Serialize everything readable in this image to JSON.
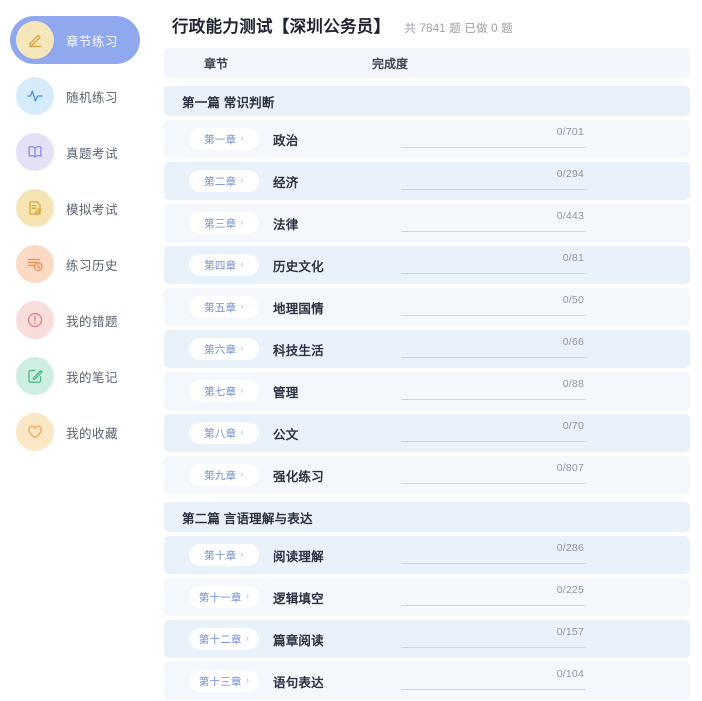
{
  "sidebar": {
    "items": [
      {
        "label": "章节练习",
        "icon": "pencil-icon",
        "icon_bg": "#f5e6bc",
        "icon_color": "#d9a441",
        "active": true
      },
      {
        "label": "随机练习",
        "icon": "pulse-icon",
        "icon_bg": "#d7ecfa",
        "icon_color": "#4a90e2",
        "active": false
      },
      {
        "label": "真题考试",
        "icon": "book-icon",
        "icon_bg": "#e2e1f7",
        "icon_color": "#8f8de0",
        "active": false
      },
      {
        "label": "模拟考试",
        "icon": "document-edit-icon",
        "icon_bg": "#f6e4b4",
        "icon_color": "#dba63c",
        "active": false
      },
      {
        "label": "练习历史",
        "icon": "history-icon",
        "icon_bg": "#fbd9c2",
        "icon_color": "#ef8f55",
        "active": false
      },
      {
        "label": "我的错题",
        "icon": "exclamation-circle-icon",
        "icon_bg": "#f9dcdc",
        "icon_color": "#e8807f",
        "active": false
      },
      {
        "label": "我的笔记",
        "icon": "note-edit-icon",
        "icon_bg": "#cdeee0",
        "icon_color": "#4cb98a",
        "active": false
      },
      {
        "label": "我的收藏",
        "icon": "heart-icon",
        "icon_bg": "#fbe7c6",
        "icon_color": "#efa95c",
        "active": false
      }
    ],
    "active_bg": "#8fa8ee"
  },
  "header": {
    "title": "行政能力测试【深圳公务员】",
    "meta": "共 7841 题 已做 0 题"
  },
  "table": {
    "columns": {
      "chapter": "章节",
      "completion": "完成度"
    },
    "sections": [
      {
        "title": "第一篇 常识判断",
        "rows": [
          {
            "chapter": "第一章",
            "name": "政治",
            "done": 0,
            "total": 701,
            "progress": "0/701"
          },
          {
            "chapter": "第二章",
            "name": "经济",
            "done": 0,
            "total": 294,
            "progress": "0/294"
          },
          {
            "chapter": "第三章",
            "name": "法律",
            "done": 0,
            "total": 443,
            "progress": "0/443"
          },
          {
            "chapter": "第四章",
            "name": "历史文化",
            "done": 0,
            "total": 81,
            "progress": "0/81"
          },
          {
            "chapter": "第五章",
            "name": "地理国情",
            "done": 0,
            "total": 50,
            "progress": "0/50"
          },
          {
            "chapter": "第六章",
            "name": "科技生活",
            "done": 0,
            "total": 66,
            "progress": "0/66"
          },
          {
            "chapter": "第七章",
            "name": "管理",
            "done": 0,
            "total": 88,
            "progress": "0/88"
          },
          {
            "chapter": "第八章",
            "name": "公文",
            "done": 0,
            "total": 70,
            "progress": "0/70"
          },
          {
            "chapter": "第九章",
            "name": "强化练习",
            "done": 0,
            "total": 807,
            "progress": "0/807"
          }
        ]
      },
      {
        "title": "第二篇 言语理解与表达",
        "rows": [
          {
            "chapter": "第十章",
            "name": "阅读理解",
            "done": 0,
            "total": 286,
            "progress": "0/286"
          },
          {
            "chapter": "第十一章",
            "name": "逻辑填空",
            "done": 0,
            "total": 225,
            "progress": "0/225"
          },
          {
            "chapter": "第十二章",
            "name": "篇章阅读",
            "done": 0,
            "total": 157,
            "progress": "0/157"
          },
          {
            "chapter": "第十三章",
            "name": "语句表达",
            "done": 0,
            "total": 104,
            "progress": "0/104"
          }
        ]
      }
    ],
    "chevron": "›"
  }
}
